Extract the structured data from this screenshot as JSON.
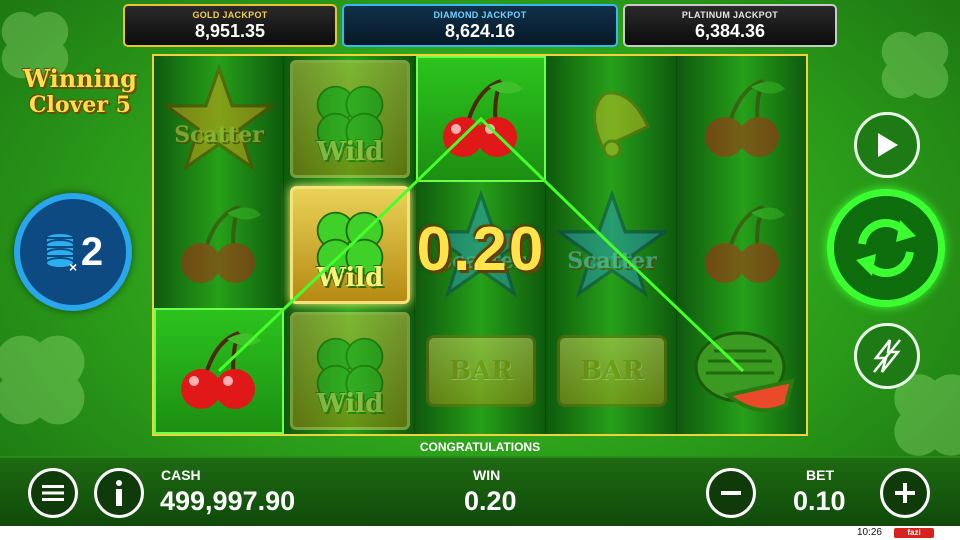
{
  "jackpots": {
    "gold": {
      "label": "GOLD JACKPOT",
      "value": "8,951.35"
    },
    "diamond": {
      "label": "DIAMOND JACKPOT",
      "value": "8,624.16"
    },
    "platinum": {
      "label": "PLATINUM JACKPOT",
      "value": "6,384.36"
    }
  },
  "game": {
    "logo_line1": "Winning",
    "logo_line2": "Clover 5",
    "multiplier": "2"
  },
  "reels": {
    "scatter_label": "Scatter",
    "wild_label": "Wild",
    "bar_label": "BAR",
    "win_overlay": "0.20"
  },
  "status": {
    "message": "CONGRATULATIONS"
  },
  "bottom_bar": {
    "cash_label": "CASH",
    "cash_value": "499,997.90",
    "win_label": "WIN",
    "win_value": "0.20",
    "bet_label": "BET",
    "bet_value": "0.10"
  },
  "system": {
    "clock": "10:26",
    "brand": "fazi"
  },
  "icons": {
    "menu": "menu-icon",
    "info": "info-icon",
    "minus": "minus-icon",
    "plus": "plus-icon",
    "autoplay": "play-icon",
    "spin": "spin-arrows-icon",
    "turbo": "lightning-icon",
    "multiplier": "coin-stack-icon"
  },
  "colors": {
    "gold": "#f2d04a",
    "diamond": "#6fd2ff",
    "platinum": "#e6e6e6",
    "spin_ring": "#3cff32",
    "win_text": "#ffe34a"
  }
}
